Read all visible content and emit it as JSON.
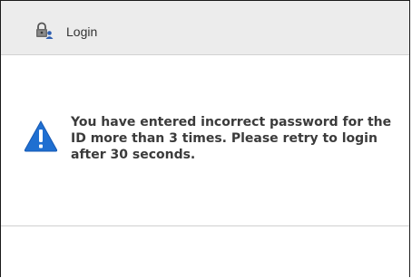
{
  "dialog": {
    "title": "Login",
    "title_icon": "lock-user-icon",
    "message": "You have entered incorrect password for the ID more than 3 times. Please retry to login after 30 seconds.",
    "message_icon": "warning-icon",
    "colors": {
      "titlebar_bg": "#ececec",
      "warning_blue": "#1f6fd1",
      "text": "#3b3b3b"
    }
  }
}
